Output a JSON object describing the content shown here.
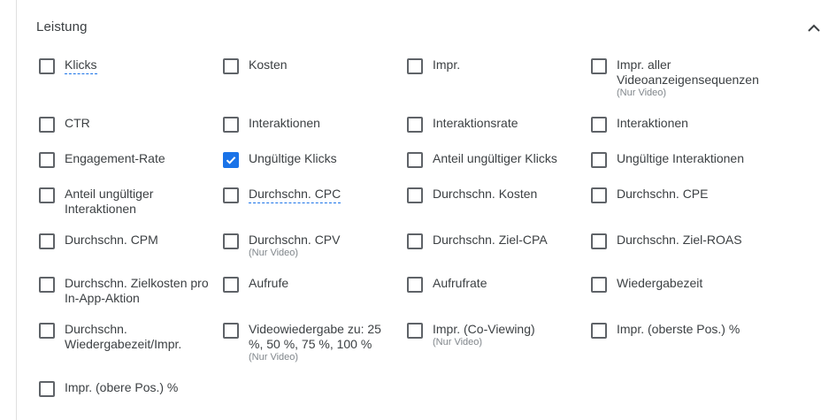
{
  "section": {
    "title": "Leistung",
    "collapse_icon": "chevron-up-icon"
  },
  "metrics": [
    {
      "label": "Klicks",
      "checked": false,
      "dotted": true,
      "note": ""
    },
    {
      "label": "Kosten",
      "checked": false,
      "dotted": false,
      "note": ""
    },
    {
      "label": "Impr.",
      "checked": false,
      "dotted": false,
      "note": ""
    },
    {
      "label": "Impr. aller Videoanzeigensequenzen",
      "checked": false,
      "dotted": false,
      "note": "(Nur Video)"
    },
    {
      "label": "CTR",
      "checked": false,
      "dotted": false,
      "note": ""
    },
    {
      "label": "Interaktionen",
      "checked": false,
      "dotted": false,
      "note": ""
    },
    {
      "label": "Interaktionsrate",
      "checked": false,
      "dotted": false,
      "note": ""
    },
    {
      "label": "Interaktionen",
      "checked": false,
      "dotted": false,
      "note": ""
    },
    {
      "label": "Engagement-Rate",
      "checked": false,
      "dotted": false,
      "note": ""
    },
    {
      "label": "Ungültige Klicks",
      "checked": true,
      "dotted": false,
      "note": ""
    },
    {
      "label": "Anteil ungültiger Klicks",
      "checked": false,
      "dotted": false,
      "note": ""
    },
    {
      "label": "Ungültige Interaktionen",
      "checked": false,
      "dotted": false,
      "note": ""
    },
    {
      "label": "Anteil ungültiger Interaktionen",
      "checked": false,
      "dotted": false,
      "note": ""
    },
    {
      "label": "Durchschn. CPC",
      "checked": false,
      "dotted": true,
      "note": ""
    },
    {
      "label": "Durchschn. Kosten",
      "checked": false,
      "dotted": false,
      "note": ""
    },
    {
      "label": "Durchschn. CPE",
      "checked": false,
      "dotted": false,
      "note": ""
    },
    {
      "label": "Durchschn. CPM",
      "checked": false,
      "dotted": false,
      "note": ""
    },
    {
      "label": "Durchschn. CPV",
      "checked": false,
      "dotted": false,
      "note": "(Nur Video)"
    },
    {
      "label": "Durchschn. Ziel-CPA",
      "checked": false,
      "dotted": false,
      "note": ""
    },
    {
      "label": "Durchschn. Ziel-ROAS",
      "checked": false,
      "dotted": false,
      "note": ""
    },
    {
      "label": "Durchschn. Zielkosten pro In-App-Aktion",
      "checked": false,
      "dotted": false,
      "note": ""
    },
    {
      "label": "Aufrufe",
      "checked": false,
      "dotted": false,
      "note": ""
    },
    {
      "label": "Aufrufrate",
      "checked": false,
      "dotted": false,
      "note": ""
    },
    {
      "label": "Wiedergabezeit",
      "checked": false,
      "dotted": false,
      "note": ""
    },
    {
      "label": "Durchschn. Wiedergabezeit/Impr.",
      "checked": false,
      "dotted": false,
      "note": ""
    },
    {
      "label": "Videowiedergabe zu: 25 %, 50 %, 75 %, 100 %",
      "checked": false,
      "dotted": false,
      "note": "(Nur Video)"
    },
    {
      "label": "Impr. (Co-Viewing)",
      "checked": false,
      "dotted": false,
      "note": "(Nur Video)"
    },
    {
      "label": "Impr. (oberste Pos.) %",
      "checked": false,
      "dotted": false,
      "note": ""
    },
    {
      "label": "Impr. (obere Pos.) %",
      "checked": false,
      "dotted": false,
      "note": ""
    }
  ],
  "colors": {
    "accent": "#1a73e8",
    "text": "#3c4043",
    "muted": "#80868b"
  }
}
